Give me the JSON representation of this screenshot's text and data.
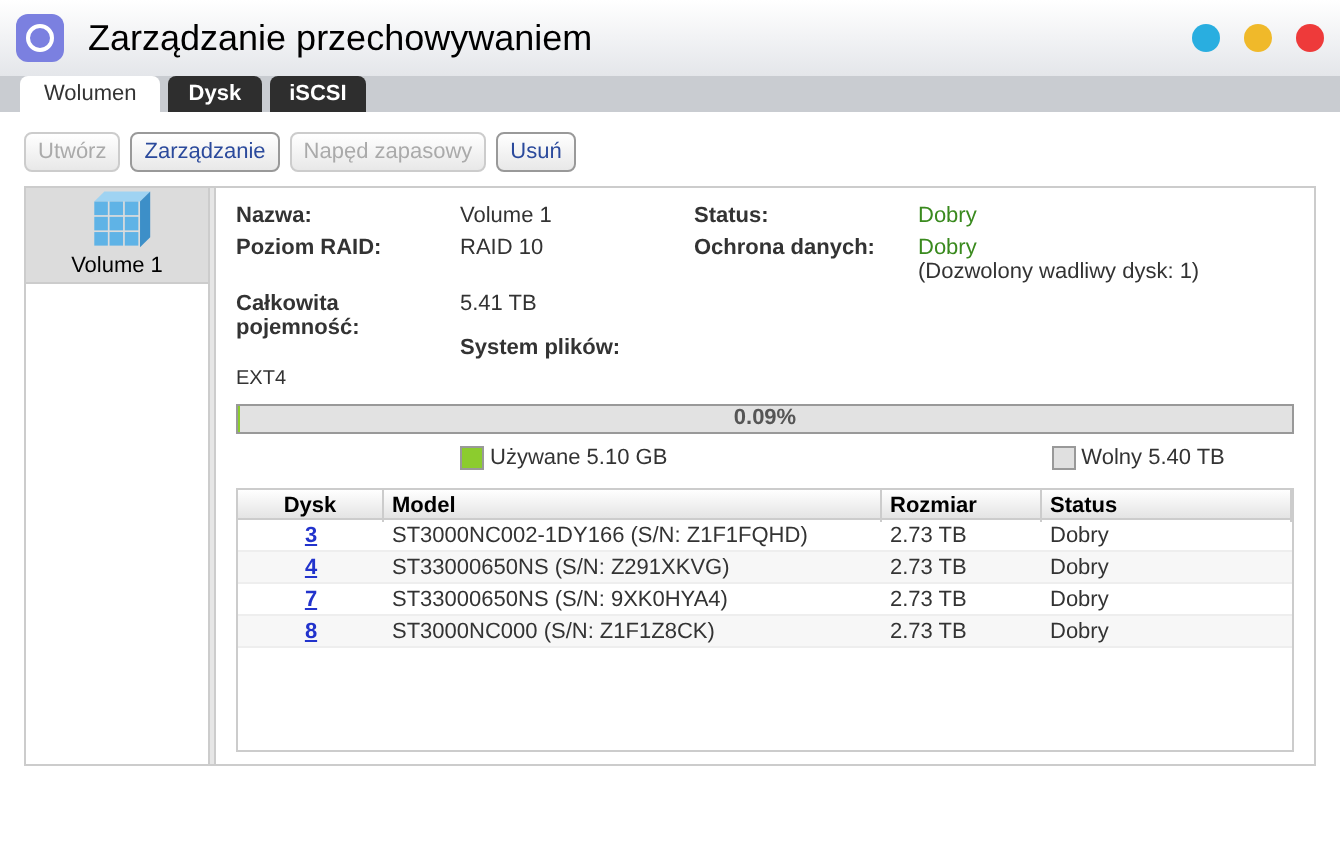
{
  "window": {
    "title": "Zarządzanie przechowywaniem"
  },
  "tabs": [
    {
      "label": "Wolumen",
      "selected": true
    },
    {
      "label": "Dysk",
      "selected": false
    },
    {
      "label": "iSCSI",
      "selected": false
    }
  ],
  "toolbar": [
    {
      "label": "Utwórz",
      "disabled": true
    },
    {
      "label": "Zarządzanie",
      "disabled": false
    },
    {
      "label": "Napęd zapasowy",
      "disabled": true
    },
    {
      "label": "Usuń",
      "disabled": false
    }
  ],
  "sidebar": {
    "items": [
      {
        "label": "Volume 1",
        "selected": true
      }
    ]
  },
  "details": {
    "name_label": "Nazwa:",
    "name": "Volume 1",
    "raid_label": "Poziom RAID:",
    "raid": "RAID 10",
    "capacity_label": "Całkowita pojemność:",
    "capacity": "5.41 TB",
    "status_label": "Status:",
    "status": "Dobry",
    "protection_label": "Ochrona danych:",
    "protection": "Dobry",
    "protection_note": "(Dozwolony wadliwy dysk: 1)",
    "fs_label": "System plików:",
    "fs": "EXT4"
  },
  "usage": {
    "level": 0.0009,
    "reading": "0.09%",
    "legend": [
      {
        "label": "Używane 5.10 GB",
        "color": "#8ccc2e"
      },
      {
        "label": "Wolny 5.40 TB",
        "color": "#e0e0e0"
      }
    ]
  },
  "table": {
    "columns": [
      "Dysk",
      "Model",
      "Rozmiar",
      "Status"
    ],
    "rows": [
      [
        "3",
        "ST3000NC002-1DY166 (S/N: Z1F1FQHD)",
        "2.73 TB",
        "Dobry"
      ],
      [
        "4",
        "ST33000650NS (S/N: Z291XKVG)",
        "2.73 TB",
        "Dobry"
      ],
      [
        "7",
        "ST33000650NS (S/N: 9XK0HYA4)",
        "2.73 TB",
        "Dobry"
      ],
      [
        "8",
        "ST3000NC000 (S/N: Z1F1Z8CK)",
        "2.73 TB",
        "Dobry"
      ]
    ]
  }
}
